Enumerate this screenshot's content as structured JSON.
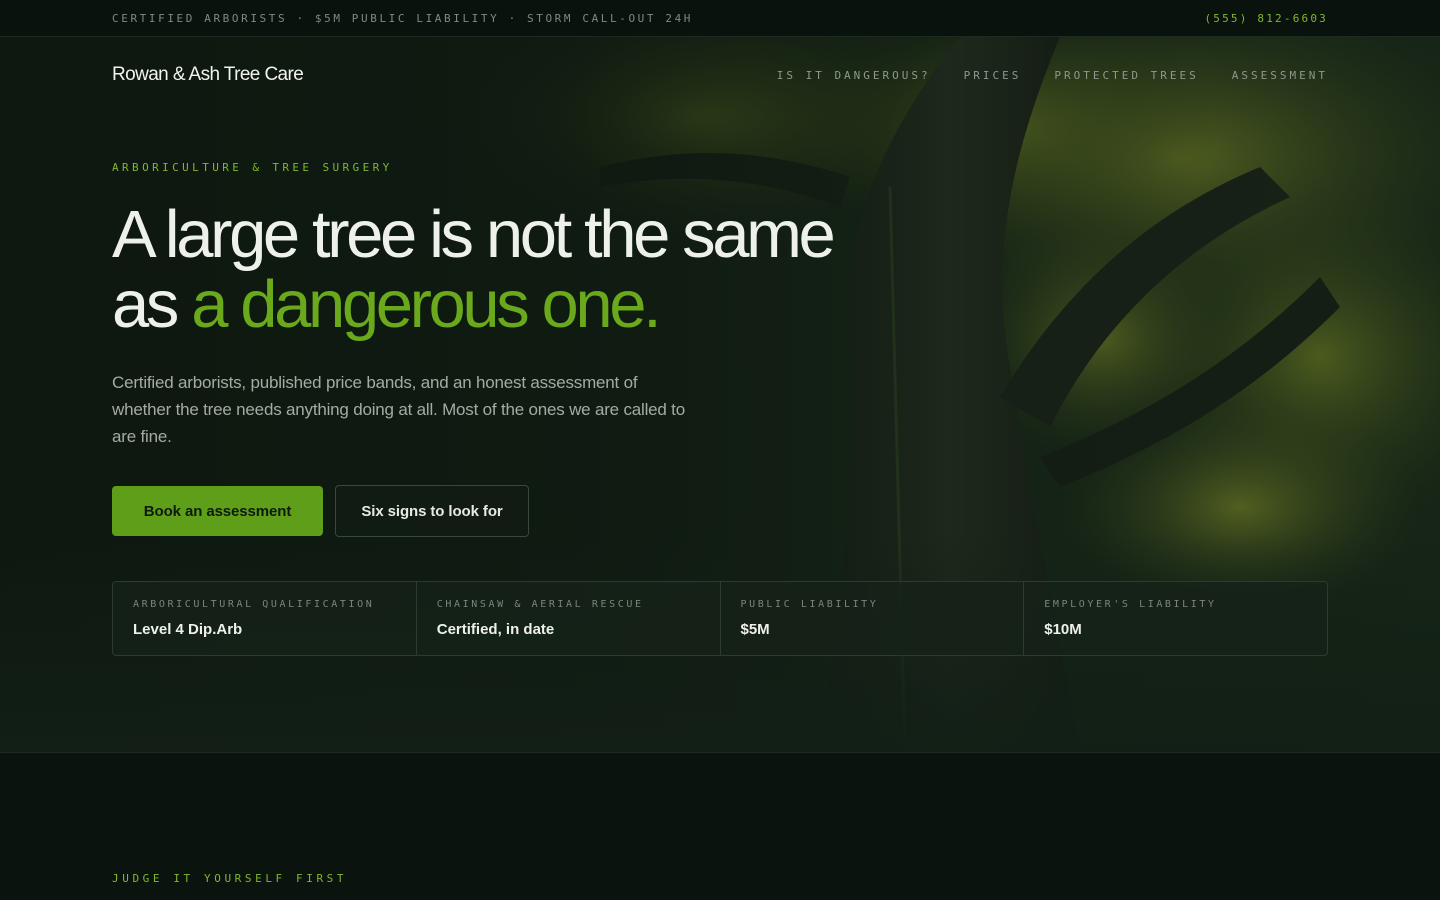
{
  "topbar": {
    "credentials": "CERTIFIED ARBORISTS · $5M PUBLIC LIABILITY · STORM CALL-OUT 24H",
    "phone": "(555) 812-6603"
  },
  "nav": {
    "brand": "Rowan & Ash Tree Care",
    "links": [
      "IS IT DANGEROUS?",
      "PRICES",
      "PROTECTED TREES",
      "ASSESSMENT"
    ]
  },
  "hero": {
    "eyebrow": "ARBORICULTURE & TREE SURGERY",
    "headline_line1": "A large tree is not the same",
    "headline_line2_prefix": "as ",
    "headline_accent": "a dangerous one.",
    "lede": "Certified arborists, published price bands, and an honest assessment of whether the tree needs anything doing at all. Most of the ones we are called to are fine.",
    "primary_button": "Book an assessment",
    "secondary_button": "Six signs to look for"
  },
  "stats": [
    {
      "label": "ARBORICULTURAL QUALIFICATION",
      "value": "Level 4 Dip.Arb"
    },
    {
      "label": "CHAINSAW & AERIAL RESCUE",
      "value": "Certified, in date"
    },
    {
      "label": "PUBLIC LIABILITY",
      "value": "$5M"
    },
    {
      "label": "EMPLOYER'S LIABILITY",
      "value": "$10M"
    }
  ],
  "next_section": {
    "eyebrow": "JUDGE IT YOURSELF FIRST"
  },
  "colors": {
    "accent": "#6aa81c",
    "button": "#5f9e18",
    "background": "#0b130e"
  }
}
